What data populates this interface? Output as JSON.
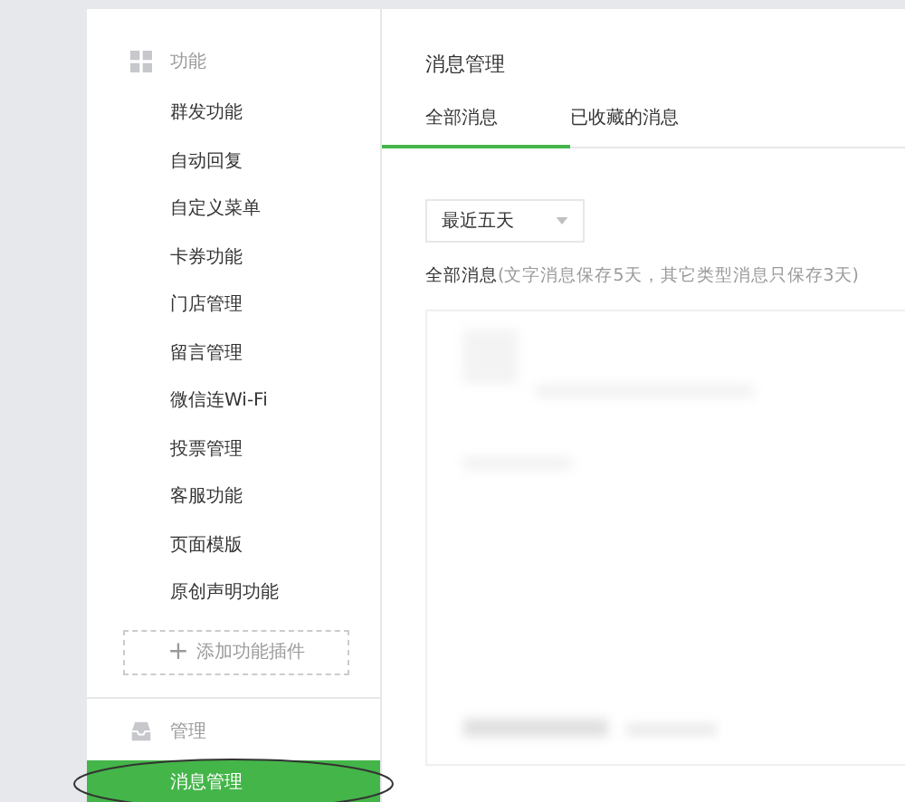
{
  "sidebar": {
    "sections": [
      {
        "title": "功能",
        "kind": "features",
        "items": [
          {
            "label": "群发功能",
            "selected": false
          },
          {
            "label": "自动回复",
            "selected": false
          },
          {
            "label": "自定义菜单",
            "selected": false
          },
          {
            "label": "卡券功能",
            "selected": false
          },
          {
            "label": "门店管理",
            "selected": false
          },
          {
            "label": "留言管理",
            "selected": false
          },
          {
            "label": "微信连Wi-Fi",
            "selected": false
          },
          {
            "label": "投票管理",
            "selected": false
          },
          {
            "label": "客服功能",
            "selected": false
          },
          {
            "label": "页面模版",
            "selected": false
          },
          {
            "label": "原创声明功能",
            "selected": false
          }
        ],
        "add_button": {
          "icon": "+",
          "label": "添加功能插件"
        }
      },
      {
        "title": "管理",
        "kind": "management",
        "items": [
          {
            "label": "消息管理",
            "selected": true
          }
        ]
      }
    ]
  },
  "main": {
    "title": "消息管理",
    "tabs": [
      {
        "label": "全部消息",
        "selected": true
      },
      {
        "label": "已收藏的消息",
        "selected": false
      }
    ],
    "filter": {
      "value": "最近五天"
    },
    "note": "**全部消息**(文字消息保存5天，其它类型消息只保存3天)"
  }
}
